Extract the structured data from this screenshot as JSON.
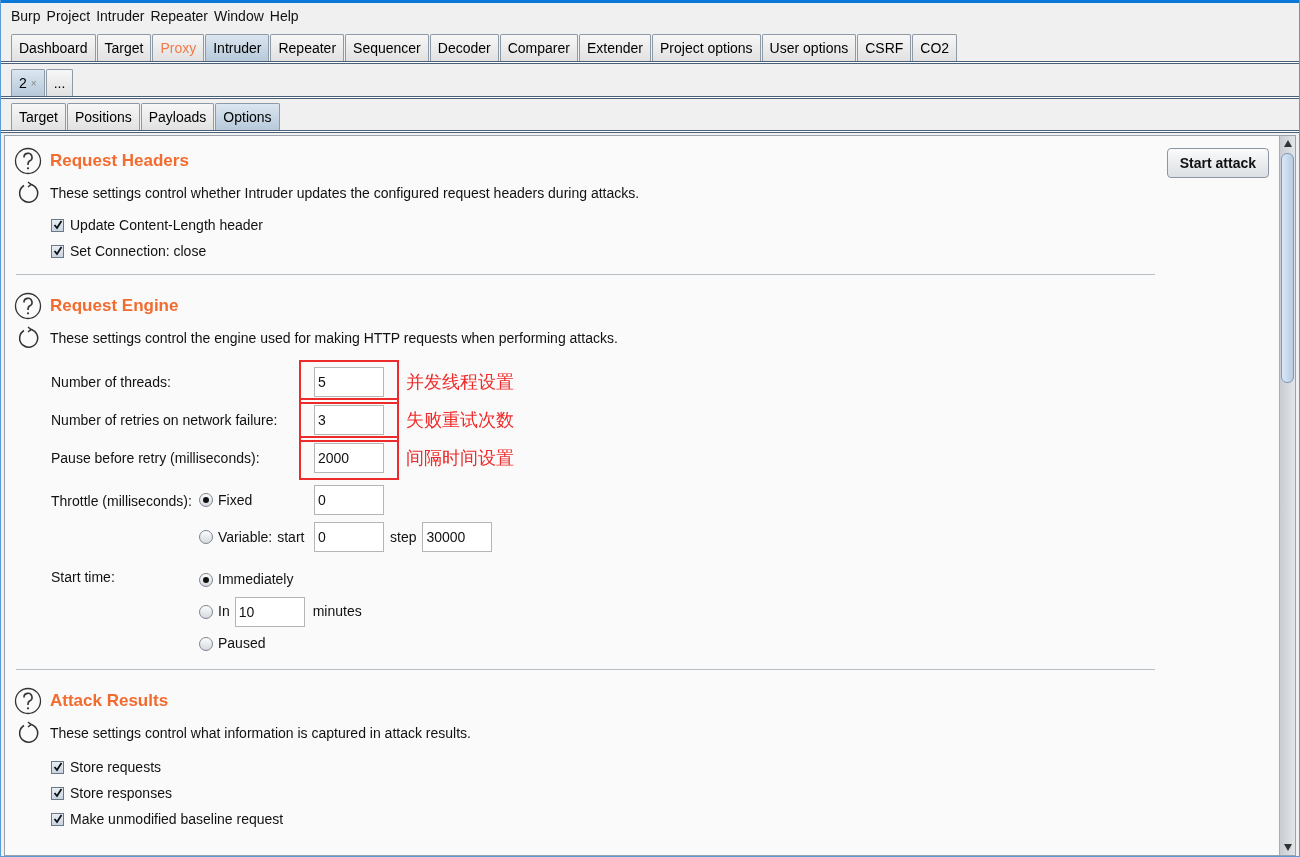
{
  "menu": [
    "Burp",
    "Project",
    "Intruder",
    "Repeater",
    "Window",
    "Help"
  ],
  "main_tabs": [
    {
      "label": "Dashboard",
      "selected": false,
      "highlighted": false
    },
    {
      "label": "Target",
      "selected": false,
      "highlighted": false
    },
    {
      "label": "Proxy",
      "selected": false,
      "highlighted": true
    },
    {
      "label": "Intruder",
      "selected": true,
      "highlighted": false
    },
    {
      "label": "Repeater",
      "selected": false,
      "highlighted": false
    },
    {
      "label": "Sequencer",
      "selected": false,
      "highlighted": false
    },
    {
      "label": "Decoder",
      "selected": false,
      "highlighted": false
    },
    {
      "label": "Comparer",
      "selected": false,
      "highlighted": false
    },
    {
      "label": "Extender",
      "selected": false,
      "highlighted": false
    },
    {
      "label": "Project options",
      "selected": false,
      "highlighted": false
    },
    {
      "label": "User options",
      "selected": false,
      "highlighted": false
    },
    {
      "label": "CSRF",
      "selected": false,
      "highlighted": false
    },
    {
      "label": "CO2",
      "selected": false,
      "highlighted": false
    }
  ],
  "attack_tabs": [
    {
      "label": "2",
      "selected": true,
      "close": "×"
    },
    {
      "label": "...",
      "selected": false
    }
  ],
  "sub_tabs": [
    {
      "label": "Target",
      "selected": false
    },
    {
      "label": "Positions",
      "selected": false
    },
    {
      "label": "Payloads",
      "selected": false
    },
    {
      "label": "Options",
      "selected": true
    }
  ],
  "start_button": "Start attack",
  "request_headers": {
    "title": "Request Headers",
    "description": "These settings control whether Intruder updates the configured request headers during attacks.",
    "checkboxes": [
      {
        "label": "Update Content-Length header",
        "checked": true
      },
      {
        "label": "Set Connection: close",
        "checked": true
      }
    ]
  },
  "request_engine": {
    "title": "Request Engine",
    "description": "These settings control the engine used for making HTTP requests when performing attacks.",
    "fields": [
      {
        "label": "Number of threads:",
        "value": "5",
        "annotation": "并发线程设置"
      },
      {
        "label": "Number of retries on network failure:",
        "value": "3",
        "annotation": "失败重试次数"
      },
      {
        "label": "Pause before retry (milliseconds):",
        "value": "2000",
        "annotation": "间隔时间设置"
      }
    ],
    "throttle": {
      "label": "Throttle (milliseconds):",
      "options": [
        {
          "kind": "field",
          "label": "Fixed",
          "selected": true,
          "value": "0"
        },
        {
          "kind": "range",
          "label": "Variable:",
          "selected": false,
          "start_label": "start",
          "start": "0",
          "step_label": "step",
          "step": "30000"
        }
      ]
    },
    "start_time": {
      "label": "Start time:",
      "options": [
        {
          "kind": "plain",
          "label": "Immediately",
          "selected": true
        },
        {
          "kind": "delay",
          "label": "In",
          "selected": false,
          "value": "10",
          "unit": "minutes"
        },
        {
          "kind": "plain",
          "label": "Paused",
          "selected": false
        }
      ]
    }
  },
  "attack_results": {
    "title": "Attack Results",
    "description": "These settings control what information is captured in attack results.",
    "checkboxes": [
      {
        "label": "Store requests",
        "checked": true
      },
      {
        "label": "Store responses",
        "checked": true
      },
      {
        "label": "Make unmodified baseline request",
        "checked": true
      }
    ]
  }
}
